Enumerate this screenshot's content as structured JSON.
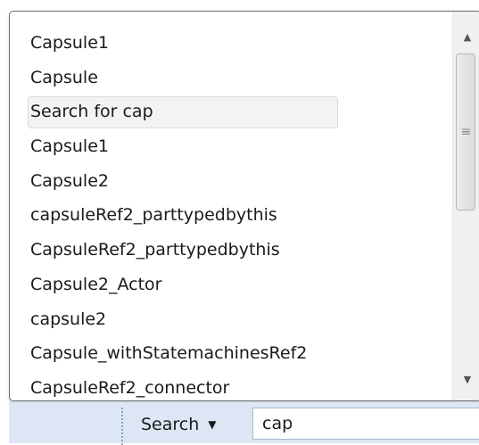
{
  "suggestions": {
    "items": [
      {
        "label": "Capsule1",
        "highlighted": false
      },
      {
        "label": "Capsule",
        "highlighted": false
      },
      {
        "label": "Search for cap",
        "highlighted": true
      },
      {
        "label": "Capsule1",
        "highlighted": false
      },
      {
        "label": "Capsule2",
        "highlighted": false
      },
      {
        "label": "capsuleRef2_parttypedbythis",
        "highlighted": false
      },
      {
        "label": "CapsuleRef2_parttypedbythis",
        "highlighted": false
      },
      {
        "label": "Capsule2_Actor",
        "highlighted": false
      },
      {
        "label": "capsule2",
        "highlighted": false
      },
      {
        "label": "Capsule_withStatemachinesRef2",
        "highlighted": false
      },
      {
        "label": "CapsuleRef2_connector",
        "highlighted": false
      }
    ]
  },
  "scrollbar": {
    "up_icon": "triangle-up-icon",
    "down_icon": "triangle-down-icon",
    "grip_icon": "grip-lines-icon",
    "position": 0.0
  },
  "toolbar": {
    "search_mode_label": "Search",
    "search_mode_icon": "triangle-down-icon",
    "search_value": "cap"
  },
  "colors": {
    "toolbar_background": "#dce6f4",
    "highlight_background": "#f3f3f3"
  }
}
